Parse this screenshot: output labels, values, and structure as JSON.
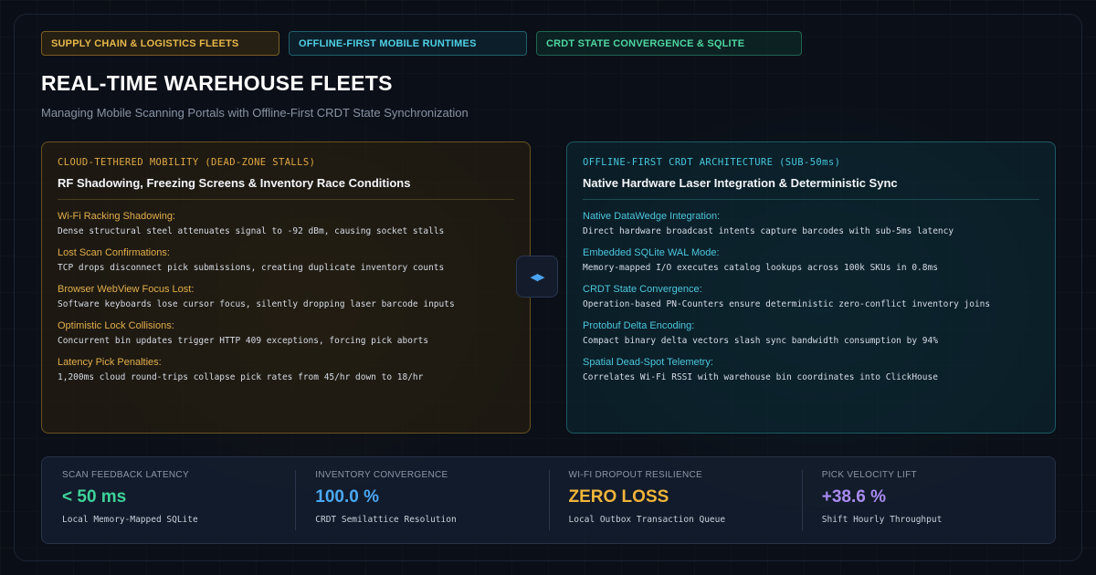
{
  "tags": [
    {
      "label": "SUPPLY CHAIN & LOGISTICS FLEETS"
    },
    {
      "label": "OFFLINE-FIRST MOBILE RUNTIMES"
    },
    {
      "label": "CRDT STATE CONVERGENCE & SQLITE"
    }
  ],
  "header": {
    "title": "REAL-TIME WAREHOUSE FLEETS",
    "subtitle": "Managing Mobile Scanning Portals with Offline-First CRDT State Synchronization"
  },
  "left_panel": {
    "kicker": "CLOUD-TETHERED MOBILITY (DEAD-ZONE STALLS)",
    "heading": "RF Shadowing, Freezing Screens & Inventory Race Conditions",
    "items": [
      {
        "label": "Wi-Fi Racking Shadowing:",
        "desc": "Dense structural steel attenuates signal to -92 dBm, causing socket stalls"
      },
      {
        "label": "Lost Scan Confirmations:",
        "desc": "TCP drops disconnect pick submissions, creating duplicate inventory counts"
      },
      {
        "label": "Browser WebView Focus Lost:",
        "desc": "Software keyboards lose cursor focus, silently dropping laser barcode inputs"
      },
      {
        "label": "Optimistic Lock Collisions:",
        "desc": "Concurrent bin updates trigger HTTP 409 exceptions, forcing pick aborts"
      },
      {
        "label": "Latency Pick Penalties:",
        "desc": "1,200ms cloud round-trips collapse pick rates from 45/hr down to 18/hr"
      }
    ]
  },
  "right_panel": {
    "kicker": "OFFLINE-FIRST CRDT ARCHITECTURE (SUB-50ms)",
    "heading": "Native Hardware Laser Integration & Deterministic Sync",
    "items": [
      {
        "label": "Native DataWedge Integration:",
        "desc": "Direct hardware broadcast intents capture barcodes with sub-5ms latency"
      },
      {
        "label": "Embedded SQLite WAL Mode:",
        "desc": "Memory-mapped I/O executes catalog lookups across 100k SKUs in 0.8ms"
      },
      {
        "label": "CRDT State Convergence:",
        "desc": "Operation-based PN-Counters ensure deterministic zero-conflict inventory joins"
      },
      {
        "label": "Protobuf Delta Encoding:",
        "desc": "Compact binary delta vectors slash sync bandwidth consumption by 94%"
      },
      {
        "label": "Spatial Dead-Spot Telemetry:",
        "desc": "Correlates Wi-Fi RSSI with warehouse bin coordinates into ClickHouse"
      }
    ]
  },
  "swap_icon": {
    "icon": "left-right-arrows-icon",
    "glyph": "◀▶"
  },
  "stats": [
    {
      "label": "SCAN FEEDBACK LATENCY",
      "value": "< 50 ms",
      "note": "Local Memory-Mapped SQLite",
      "color": "#3fd39a"
    },
    {
      "label": "INVENTORY CONVERGENCE",
      "value": "100.0 %",
      "note": "CRDT Semilattice Resolution",
      "color": "#4aa8f2"
    },
    {
      "label": "WI-FI DROPOUT RESILIENCE",
      "value": "ZERO LOSS",
      "note": "Local Outbox Transaction Queue",
      "color": "#f0b43a"
    },
    {
      "label": "PICK VELOCITY LIFT",
      "value": "+38.6 %",
      "note": "Shift Hourly Throughput",
      "color": "#a98bf0"
    }
  ]
}
